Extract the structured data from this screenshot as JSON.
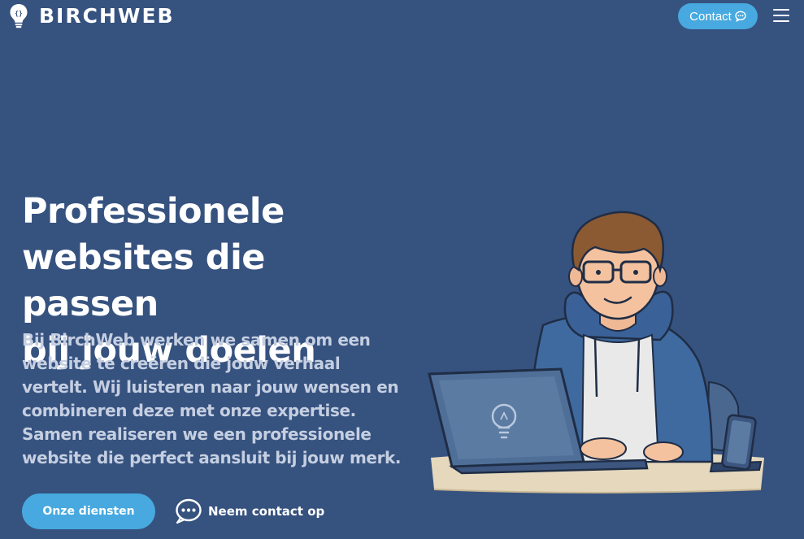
{
  "header": {
    "logo_text": "BIRCHWEB",
    "logo_icon": "lightbulb-icon",
    "contact_label": "Contact",
    "contact_icon": "chat-bubble-icon",
    "menu_icon": "hamburger-menu-icon"
  },
  "hero": {
    "title_lines": [
      "Professionele",
      "websites die passen",
      "bij jouw doelen"
    ],
    "text_lines": [
      "Bij BirchWeb werken we samen om een",
      "website te creëren die jouw verhaal",
      "vertelt. Wij luisteren naar jouw wensen en",
      "combineren deze met onze expertise.",
      "Samen realiseren we een professionele",
      "website die perfect aansluit bij jouw merk."
    ],
    "primary_button": "Onze diensten",
    "secondary_button": "Neem contact op",
    "secondary_icon": "chat-bubble-icon",
    "illustration": "developer-at-laptop-illustration"
  },
  "colors": {
    "background": "#36527f",
    "accent": "#47a9df",
    "text": "#ffffff",
    "muted_text": "#c5cfe1"
  }
}
